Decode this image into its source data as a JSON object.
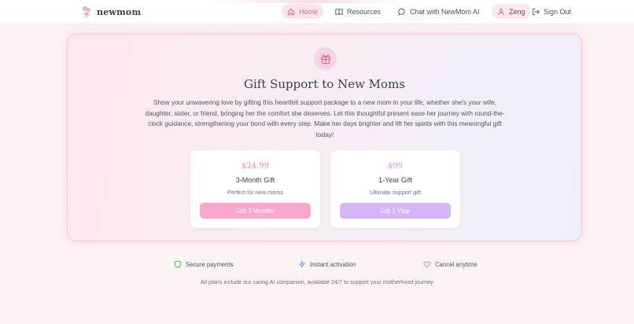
{
  "nav": {
    "brand": "newmom",
    "items": [
      {
        "label": "Home",
        "icon": "home-icon"
      },
      {
        "label": "Resources",
        "icon": "book-icon"
      },
      {
        "label": "Chat with NewMom AI",
        "icon": "chat-bubble-icon"
      }
    ],
    "user": {
      "name": "Zeng",
      "icon": "user-icon"
    },
    "signout": {
      "label": "Sign Out",
      "icon": "sign-out-icon"
    }
  },
  "hero": {
    "icon": "gift-icon",
    "title": "Gift Support to New Moms",
    "description": "Show your unwavering love by gifting this heartfelt support package to a new mom in your life, whether she's your wife, daughter, sister, or friend, bringing her the comfort she deserves. Let this thoughtful present ease her journey with round-the-clock guidance, strengthening your bond with every step. Make her days brighter and lift her spirits with this meaningful gift today!"
  },
  "plans": [
    {
      "price": "$24.99",
      "name": "3-Month Gift",
      "subtitle": "Perfect for new moms",
      "button": "Gift 3 Months"
    },
    {
      "price": "$99",
      "name": "1-Year Gift",
      "subtitle": "Ultimate support gift",
      "button": "Gift 1 Year"
    }
  ],
  "features": [
    {
      "label": "Secure payments",
      "icon": "shield-icon"
    },
    {
      "label": "Instant activation",
      "icon": "lightning-icon"
    },
    {
      "label": "Cancel anytime",
      "icon": "heart-icon"
    }
  ],
  "footnote": "All plans include our caring AI companion, available 24/7 to support your motherhood journey",
  "colors": {
    "accent_pink": "#f9a8cc",
    "accent_purple": "#d6b4f5",
    "home_active": "#e3618f",
    "background": "#fdf2f4"
  }
}
